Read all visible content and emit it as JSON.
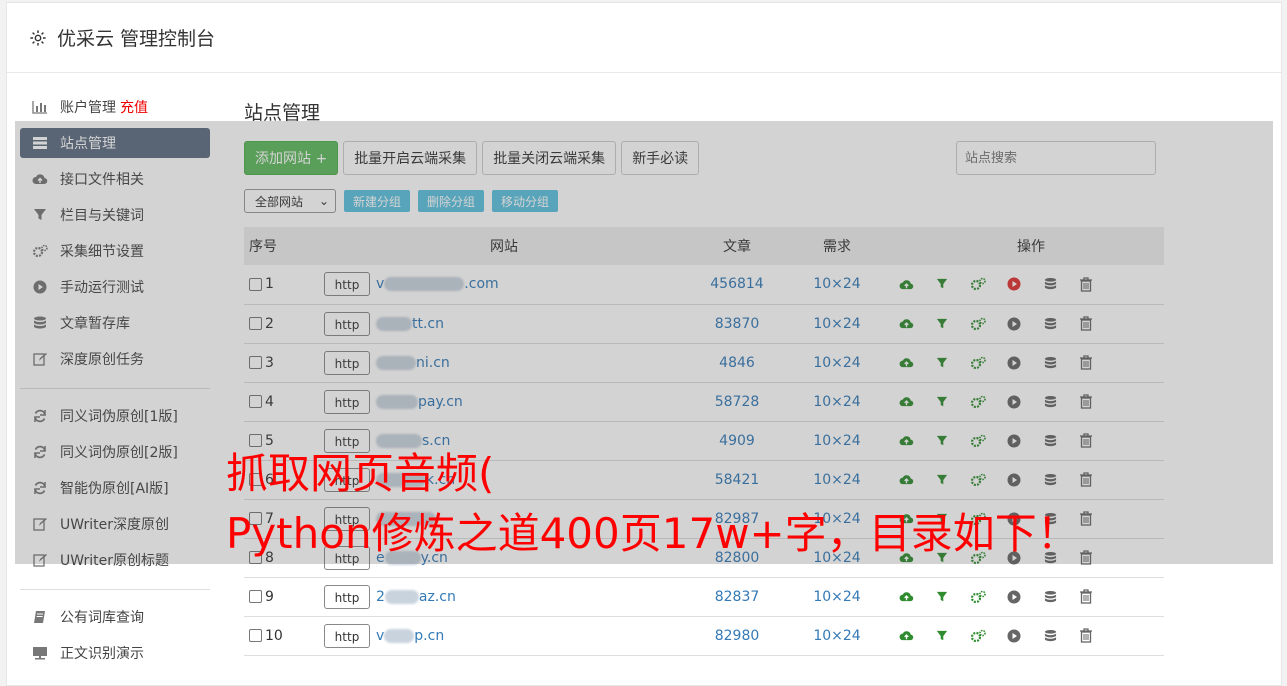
{
  "app": {
    "title": "优采云 管理控制台"
  },
  "sidebar": {
    "group1": [
      {
        "label": "账户管理",
        "badge": "充值",
        "icon": "bar-chart-icon"
      },
      {
        "label": "站点管理",
        "icon": "server-icon",
        "active": true
      },
      {
        "label": "接口文件相关",
        "icon": "cloud-upload-icon"
      },
      {
        "label": "栏目与关键词",
        "icon": "filter-icon"
      },
      {
        "label": "采集细节设置",
        "icon": "cogs-icon"
      },
      {
        "label": "手动运行测试",
        "icon": "play-circle-icon"
      },
      {
        "label": "文章暂存库",
        "icon": "database-icon"
      },
      {
        "label": "深度原创任务",
        "icon": "edit-icon"
      }
    ],
    "group2": [
      {
        "label": "同义词伪原创[1版]",
        "icon": "refresh-icon"
      },
      {
        "label": "同义词伪原创[2版]",
        "icon": "refresh-icon"
      },
      {
        "label": "智能伪原创[AI版]",
        "icon": "refresh-icon"
      },
      {
        "label": "UWriter深度原创",
        "icon": "edit-icon"
      },
      {
        "label": "UWriter原创标题",
        "icon": "edit-icon"
      }
    ],
    "group3": [
      {
        "label": "公有词库查询",
        "icon": "book-icon"
      },
      {
        "label": "正文识别演示",
        "icon": "monitor-icon"
      }
    ]
  },
  "main": {
    "title": "站点管理",
    "toolbar": {
      "add": "添加网站 +",
      "batch_on": "批量开启云端采集",
      "batch_off": "批量关闭云端采集",
      "guide": "新手必读",
      "search_placeholder": "站点搜索"
    },
    "group_select": "全部网站",
    "group_buttons": [
      "新建分组",
      "删除分组",
      "移动分组"
    ],
    "table": {
      "headers": [
        "序号",
        "网站",
        "文章",
        "需求",
        "操作"
      ],
      "rows": [
        {
          "no": "1",
          "prefix": "v",
          "suffix": ".com",
          "articles": "456814",
          "req": "10×24",
          "running": true
        },
        {
          "no": "2",
          "prefix": "",
          "suffix": "tt.cn",
          "articles": "83870",
          "req": "10×24",
          "running": false
        },
        {
          "no": "3",
          "prefix": "",
          "suffix": "ni.cn",
          "articles": "4846",
          "req": "10×24",
          "running": false
        },
        {
          "no": "4",
          "prefix": "",
          "suffix": "pay.cn",
          "articles": "58728",
          "req": "10×24",
          "running": false
        },
        {
          "no": "5",
          "prefix": "",
          "suffix": "s.cn",
          "articles": "4909",
          "req": "10×24",
          "running": false
        },
        {
          "no": "6",
          "prefix": "",
          "suffix": "k.cn",
          "articles": "58421",
          "req": "10×24",
          "running": false
        },
        {
          "no": "7",
          "prefix": "",
          "suffix": "",
          "articles": "82987",
          "req": "10×24",
          "running": false
        },
        {
          "no": "8",
          "prefix": "e",
          "suffix": "y.cn",
          "articles": "82800",
          "req": "10×24",
          "running": false
        },
        {
          "no": "9",
          "prefix": "2",
          "suffix": "az.cn",
          "articles": "82837",
          "req": "10×24",
          "running": false
        },
        {
          "no": "10",
          "prefix": "v",
          "suffix": "p.cn",
          "articles": "82980",
          "req": "10×24",
          "running": false
        }
      ],
      "http_label": "http"
    }
  },
  "overlay_caption": {
    "line1": "抓取网页音频(",
    "line2": "Python修炼之道400页17w+字，目录如下！"
  },
  "colors": {
    "accent": "#5cb85c",
    "link": "#337ab7",
    "active_nav": "#5c6b80",
    "caption": "#ff0000"
  }
}
